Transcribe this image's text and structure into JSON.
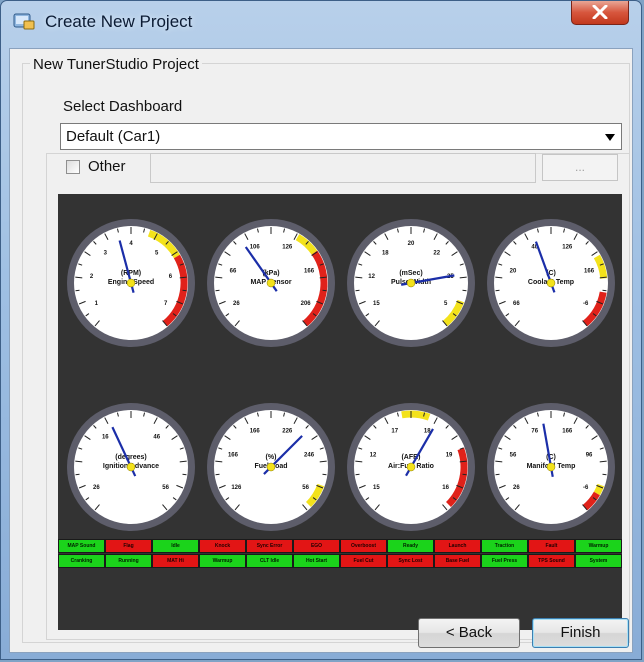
{
  "window": {
    "title": "Create New Project",
    "close_glyph": "X",
    "app_icon": "tunerstudio-project-icon"
  },
  "project_group": {
    "title": "New TunerStudio Project"
  },
  "dashboard_group": {
    "title": "Select Dashboard",
    "selected": "Default (Car1)",
    "other_label": "Other",
    "other_checked": false,
    "other_path": "",
    "browse_label": "..."
  },
  "preview": {
    "gauges": [
      {
        "label": "Engine Speed",
        "units": "(RPM)",
        "ticks": [
          "1",
          "2",
          "3",
          "4",
          "5",
          "6",
          "7"
        ],
        "needle_deg": -15,
        "yellow": [
          20,
          60
        ],
        "red": [
          60,
          140
        ]
      },
      {
        "label": "MAP Sensor",
        "units": "(kPa)",
        "ticks": [
          "26",
          "66",
          "106",
          "126",
          "166",
          "206"
        ],
        "needle_deg": -35,
        "yellow": [
          30,
          55
        ],
        "red": [
          55,
          140
        ]
      },
      {
        "label": "Pulse Width",
        "units": "(mSec)",
        "ticks": [
          "15",
          "12",
          "18",
          "20",
          "22",
          "25",
          "5"
        ],
        "needle_deg": 80,
        "yellow": [
          110,
          140
        ],
        "red": []
      },
      {
        "label": "Coolant Temp",
        "units": "(C)",
        "ticks": [
          "66",
          "20",
          "40",
          "126",
          "166",
          "-6"
        ],
        "needle_deg": -20,
        "yellow": [
          60,
          85
        ],
        "red": [
          100,
          140
        ]
      },
      {
        "label": "Ignition Advance",
        "units": "(degrees)",
        "ticks": [
          "26",
          "16",
          "46",
          "56"
        ],
        "needle_deg": -25,
        "yellow": [],
        "red": []
      },
      {
        "label": "Fuel Load",
        "units": "(%)",
        "ticks": [
          "126",
          "166",
          "166",
          "226",
          "246",
          "56"
        ],
        "needle_deg": 45,
        "yellow": [
          110,
          135
        ],
        "red": []
      },
      {
        "label": "Air:Fuel Ratio",
        "units": "(AFR)",
        "ticks": [
          "15",
          "12",
          "17",
          "18",
          "19",
          "16"
        ],
        "needle_deg": 30,
        "yellow": [
          -10,
          20
        ],
        "red": [
          70,
          135
        ]
      },
      {
        "label": "Manifold Temp",
        "units": "(C)",
        "ticks": [
          "26",
          "56",
          "76",
          "166",
          "96",
          "-6"
        ],
        "needle_deg": -10,
        "yellow": [
          110,
          120
        ],
        "red": [
          120,
          140
        ]
      }
    ],
    "indicators_top": [
      {
        "text": "MAP Sound",
        "on": true
      },
      {
        "text": "Flag",
        "on": false
      },
      {
        "text": "Idle",
        "on": true
      },
      {
        "text": "Knock",
        "on": false
      },
      {
        "text": "Sync Error",
        "on": false
      },
      {
        "text": "EGO",
        "on": false
      },
      {
        "text": "Overboost",
        "on": false
      },
      {
        "text": "Ready",
        "on": true
      },
      {
        "text": "Launch",
        "on": false
      },
      {
        "text": "Traction",
        "on": true
      },
      {
        "text": "Fault",
        "on": false
      },
      {
        "text": "Warmup",
        "on": true
      }
    ],
    "indicators_bottom": [
      {
        "text": "Cranking",
        "on": true
      },
      {
        "text": "Running",
        "on": true
      },
      {
        "text": "MAT Hi",
        "on": false
      },
      {
        "text": "Warmup",
        "on": true
      },
      {
        "text": "CLT Idle",
        "on": true
      },
      {
        "text": "Hot Start",
        "on": true
      },
      {
        "text": "Fuel Cut",
        "on": false
      },
      {
        "text": "Sync Lost",
        "on": false
      },
      {
        "text": "Base Fuel",
        "on": false
      },
      {
        "text": "Fuel Press",
        "on": true
      },
      {
        "text": "TPS Sound",
        "on": false
      },
      {
        "text": "System",
        "on": true
      }
    ],
    "colors": {
      "on": "#1bd31b",
      "off": "#e21515",
      "panel": "#333333"
    }
  },
  "buttons": {
    "back": "< Back",
    "finish": "Finish"
  }
}
